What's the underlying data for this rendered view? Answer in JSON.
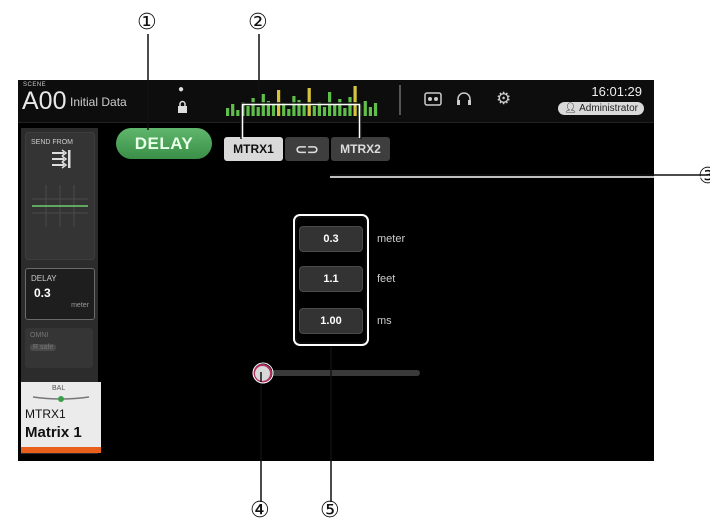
{
  "callouts": [
    "①",
    "②",
    "③",
    "④",
    "⑤"
  ],
  "header": {
    "scene_label": "SCENE",
    "scene_number": "A00",
    "scene_title": "Initial Data",
    "time": "16:01:29",
    "user": "Administrator",
    "icons": [
      "e-icon",
      "lock-icon",
      "meter-bridge",
      "recorder-icon",
      "headphones-icon",
      "gear-icon",
      "user-icon"
    ]
  },
  "strip": {
    "send_from_label": "SEND FROM",
    "delay_label": "DELAY",
    "delay_value": "0.3",
    "delay_unit": "meter",
    "omni_label": "OMNI",
    "omni_status": "R safe",
    "bal_label": "BAL",
    "channel_id": "MTRX1",
    "channel_name": "Matrix 1",
    "channel_color": "#e8601c"
  },
  "main": {
    "delay_button": "DELAY",
    "delay_on_color": "#4aa35a",
    "matrix_buttons": [
      "MTRX1",
      "MTRX2"
    ],
    "link_icon": "⊂⊃",
    "values": [
      {
        "value": "0.3",
        "unit": "meter"
      },
      {
        "value": "1.1",
        "unit": "feet"
      },
      {
        "value": "1.00",
        "unit": "ms"
      }
    ],
    "slider_level": 0.0
  },
  "annotation_color": "#111111"
}
